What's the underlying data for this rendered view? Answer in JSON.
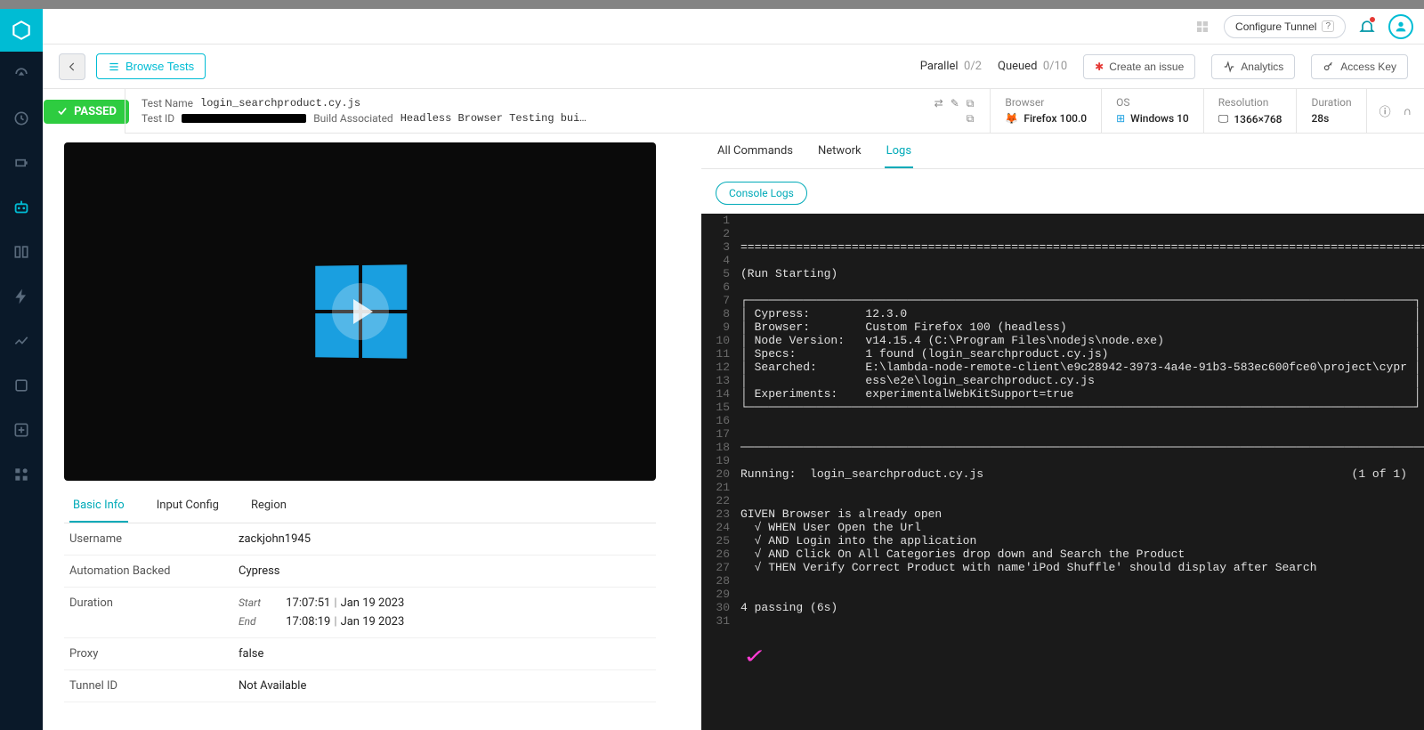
{
  "header": {
    "configure_tunnel": "Configure Tunnel",
    "browse_tests": "Browse Tests",
    "parallel_label": "Parallel",
    "parallel_value": "0/2",
    "queued_label": "Queued",
    "queued_value": "0/10",
    "create_issue": "Create an issue",
    "analytics": "Analytics",
    "access_key": "Access Key"
  },
  "status": {
    "label": "PASSED"
  },
  "test_meta": {
    "test_name_label": "Test Name",
    "test_name": "login_searchproduct.cy.js",
    "test_id_label": "Test ID",
    "build_assoc_label": "Build Associated",
    "build_assoc": "Headless Browser Testing bui…"
  },
  "env": {
    "browser_label": "Browser",
    "browser": "Firefox 100.0",
    "os_label": "OS",
    "os": "Windows 10",
    "resolution_label": "Resolution",
    "resolution": "1366×768",
    "duration_label": "Duration",
    "duration": "28s"
  },
  "info_tabs": {
    "basic": "Basic Info",
    "input": "Input Config",
    "region": "Region"
  },
  "basic_info": {
    "username_label": "Username",
    "username": "zackjohn1945",
    "backed_label": "Automation Backed",
    "backed": "Cypress",
    "duration_label": "Duration",
    "start_label": "Start",
    "start_time": "17:07:51",
    "start_date": "Jan 19 2023",
    "end_label": "End",
    "end_time": "17:08:19",
    "end_date": "Jan 19 2023",
    "proxy_label": "Proxy",
    "proxy": "false",
    "tunnel_label": "Tunnel ID",
    "tunnel": "Not Available"
  },
  "log_tabs": {
    "all": "All Commands",
    "network": "Network",
    "logs": "Logs"
  },
  "console_chip": "Console Logs",
  "console_lines": [
    "",
    "",
    "====================================================================================================",
    "",
    "(Run Starting)",
    "",
    "┌────────────────────────────────────────────────────────────────────────────────────────────────┐",
    "│ Cypress:        12.3.0                                                                         │",
    "│ Browser:        Custom Firefox 100 (headless)                                                  │",
    "│ Node Version:   v14.15.4 (C:\\Program Files\\nodejs\\node.exe)                                    │",
    "│ Specs:          1 found (login_searchproduct.cy.js)                                            │",
    "│ Searched:       E:\\lambda-node-remote-client\\e9c28942-3973-4a4e-91b3-583ec600fce0\\project\\cypr │",
    "│                 ess\\e2e\\login_searchproduct.cy.js                                              │",
    "│ Experiments:    experimentalWebKitSupport=true                                                 │",
    "└────────────────────────────────────────────────────────────────────────────────────────────────┘",
    "",
    "",
    "────────────────────────────────────────────────────────────────────────────────────────────────────",
    "",
    "Running:  login_searchproduct.cy.js                                                     (1 of 1)",
    "",
    "",
    "GIVEN Browser is already open",
    "  √ WHEN User Open the Url",
    "  √ AND Login into the application",
    "  √ AND Click On All Categories drop down and Search the Product",
    "  √ THEN Verify Correct Product with name'iPod Shuffle' should display after Search",
    "",
    "",
    "4 passing (6s)",
    ""
  ],
  "chart_data": null
}
